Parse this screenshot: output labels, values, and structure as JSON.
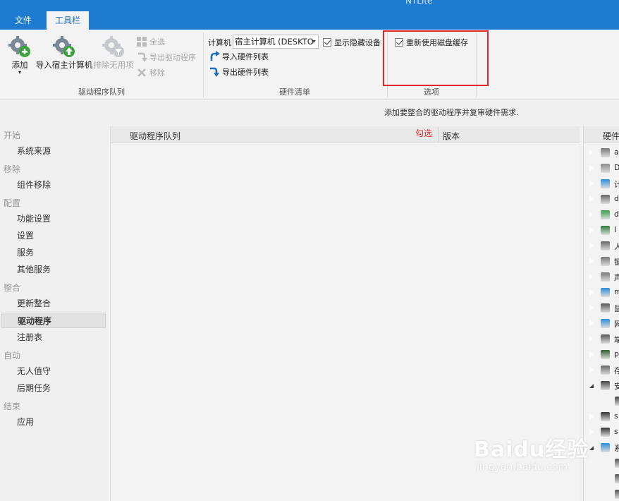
{
  "app": {
    "title": "NTLite"
  },
  "tabs": [
    {
      "label": "文件"
    },
    {
      "label": "工具栏"
    }
  ],
  "ribbon": {
    "driver_queue": {
      "title": "驱动程序队列",
      "add": "添加",
      "import_host": "导入宿主计算机",
      "exclude_unused": "排除无用项",
      "select_all": "全选",
      "export_drivers": "导出驱动程序",
      "remove": "移除"
    },
    "hardware_list": {
      "title": "硬件清单",
      "computer_label": "计算机",
      "computer_value": "宿主计算机 (DESKTO",
      "show_hidden": "显示隐藏设备",
      "import_hw": "导入硬件列表",
      "export_hw": "导出硬件列表"
    },
    "options": {
      "title": "选项",
      "reuse_cache": "重新使用磁盘缓存"
    }
  },
  "info_text": "添加要整合的驱动程序并复审硬件需求.",
  "leftnav": {
    "sections": [
      {
        "label": "开始",
        "items": [
          "系统来源"
        ]
      },
      {
        "label": "移除",
        "items": [
          "组件移除"
        ]
      },
      {
        "label": "配置",
        "items": [
          "功能设置",
          "设置",
          "服务",
          "其他服务"
        ]
      },
      {
        "label": "整合",
        "items": [
          "更新整合",
          "驱动程序",
          "注册表"
        ]
      },
      {
        "label": "自动",
        "items": [
          "无人值守",
          "后期任务"
        ]
      },
      {
        "label": "结束",
        "items": [
          "应用"
        ]
      }
    ],
    "active": "驱动程序"
  },
  "driver_list": {
    "col_queue": "驱动程序队列",
    "col_version": "版本",
    "annotation": "勾选"
  },
  "hw_tree": {
    "header": "硬件",
    "rows": [
      {
        "icon": "speaker-icon",
        "label": "a"
      },
      {
        "icon": "disc-drive-icon",
        "label": "D"
      },
      {
        "icon": "monitor-icon",
        "label": "计"
      },
      {
        "icon": "drive-icon",
        "label": "d"
      },
      {
        "icon": "display-adapter-icon",
        "label": "d"
      },
      {
        "icon": "ide-controller-icon",
        "label": "I"
      },
      {
        "icon": "hid-icon",
        "label": "人"
      },
      {
        "icon": "keyboard-icon",
        "label": "键"
      },
      {
        "icon": "audio-icon",
        "label": "声"
      },
      {
        "icon": "monitor-icon",
        "label": "m"
      },
      {
        "icon": "mouse-icon",
        "label": "鼠"
      },
      {
        "icon": "network-icon",
        "label": "网"
      },
      {
        "icon": "port-icon",
        "label": "端"
      },
      {
        "icon": "processor-icon",
        "label": "p"
      },
      {
        "icon": "storage-icon",
        "label": "存"
      },
      {
        "icon": "security-icon",
        "label": "安"
      },
      {
        "icon": "sub-device-icon",
        "label": ""
      },
      {
        "icon": "software-device-icon",
        "label": "s"
      },
      {
        "icon": "software-device-icon",
        "label": "s"
      },
      {
        "icon": "system-folder-icon",
        "label": "系"
      },
      {
        "icon": "system-device-icon",
        "label": ""
      },
      {
        "icon": "system-device-icon",
        "label": ""
      },
      {
        "icon": "system-device-icon",
        "label": ""
      }
    ]
  },
  "watermark": {
    "brand": "Baidu经验",
    "url": "jingyan.baidu.com"
  }
}
